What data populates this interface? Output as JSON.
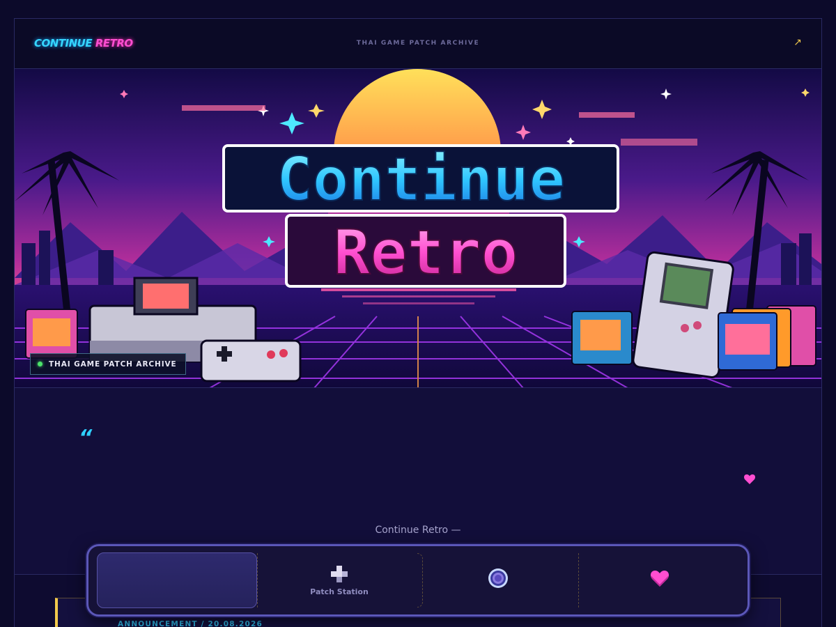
{
  "header": {
    "brand_part1": "CONTINUE",
    "brand_part2": "RETRO",
    "tagline": "THAI GAME PATCH ARCHIVE",
    "external_link_glyph": "↗"
  },
  "hero": {
    "title_line1": "Continue",
    "title_line2": "Retro",
    "badge_label": "THAI GAME PATCH ARCHIVE"
  },
  "quote": {
    "mark": "“",
    "attribution": "Continue Retro —"
  },
  "announcement": {
    "meta": "ANNOUNCEMENT / 20.08.2026"
  },
  "dock": {
    "items": [
      {
        "label": "",
        "icon": "blank"
      },
      {
        "label": "Patch Station",
        "icon": "plus-icon"
      },
      {
        "label": "",
        "icon": "ring-icon"
      },
      {
        "label": "",
        "icon": "heart-icon"
      }
    ]
  },
  "colors": {
    "background": "#0c0a2a",
    "cyan": "#35d6ff",
    "pink": "#ff4ed1",
    "gold": "#f2c94c",
    "dock_border": "#5b57b8",
    "status_dot": "#4be36a"
  }
}
